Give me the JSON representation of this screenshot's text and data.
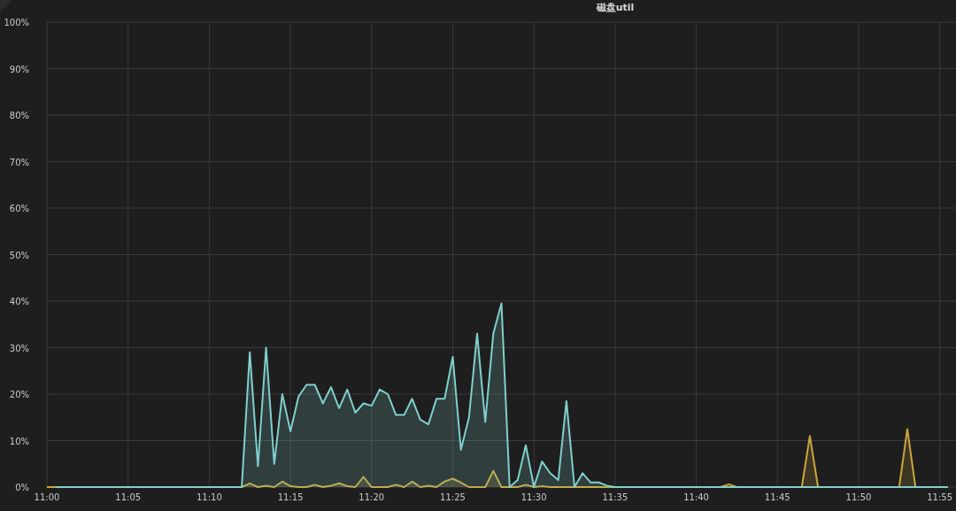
{
  "panel": {
    "title": "磁盘util",
    "chart_data": {
      "type": "area",
      "grid": true,
      "categories": [
        "11:00",
        null,
        null,
        null,
        null,
        null,
        null,
        null,
        null,
        null,
        "11:05",
        null,
        null,
        null,
        null,
        null,
        null,
        null,
        null,
        null,
        "11:10",
        null,
        null,
        null,
        null,
        null,
        null,
        null,
        null,
        null,
        "11:15",
        null,
        null,
        null,
        null,
        null,
        null,
        null,
        null,
        null,
        "11:20",
        null,
        null,
        null,
        null,
        null,
        null,
        null,
        null,
        null,
        "11:25",
        null,
        null,
        null,
        null,
        null,
        null,
        null,
        null,
        null,
        "11:30",
        null,
        null,
        null,
        null,
        null,
        null,
        null,
        null,
        null,
        "11:35",
        null,
        null,
        null,
        null,
        null,
        null,
        null,
        null,
        null,
        "11:40",
        null,
        null,
        null,
        null,
        null,
        null,
        null,
        null,
        null,
        "11:45",
        null,
        null,
        null,
        null,
        null,
        null,
        null,
        null,
        null,
        "11:50",
        null,
        null,
        null,
        null,
        null,
        null,
        null,
        null,
        null,
        "11:55",
        null
      ],
      "series": [
        {
          "color": "#7fd0cc",
          "values": [
            null,
            0,
            0,
            0,
            0,
            0,
            0,
            0,
            0,
            0,
            0,
            0,
            0,
            0,
            0,
            0,
            0,
            0,
            0,
            0,
            0,
            0,
            0,
            0,
            0,
            29,
            4.5,
            30,
            5,
            20,
            12,
            19.5,
            22,
            22,
            18,
            21.5,
            17,
            21,
            16,
            18,
            17.5,
            21,
            20,
            15.5,
            15.5,
            19,
            14.5,
            13.5,
            19,
            19,
            28,
            8,
            15,
            33,
            14,
            33,
            39.5,
            0,
            1.5,
            9,
            0,
            5.5,
            3,
            1.5,
            18.5,
            0,
            3,
            1,
            1,
            0.3,
            0,
            0,
            0,
            0,
            0,
            0,
            0,
            0,
            0,
            0,
            0,
            0,
            0,
            0,
            0,
            0,
            0,
            0,
            0,
            0,
            0,
            0,
            0,
            0,
            0,
            0,
            0,
            0,
            0,
            0,
            0,
            0,
            0,
            0,
            0,
            0,
            0,
            0,
            0,
            0,
            0,
            0
          ]
        },
        {
          "color": "#c9a63c",
          "values": [
            0,
            0,
            0,
            0,
            0,
            0,
            0,
            0,
            0,
            0,
            0,
            0,
            0,
            0,
            0,
            0,
            0,
            0,
            0,
            0,
            0,
            0,
            0,
            0,
            0,
            0.8,
            0,
            0.3,
            0,
            1.2,
            0.2,
            0,
            0,
            0.5,
            0,
            0.3,
            0.8,
            0.2,
            0,
            2.2,
            0,
            0,
            0,
            0.5,
            0,
            1.2,
            0,
            0.3,
            0,
            1.2,
            1.8,
            1,
            0,
            0,
            0,
            3.5,
            0,
            0,
            0,
            0.5,
            0,
            0.2,
            0,
            0,
            0,
            0,
            0,
            0,
            0,
            0,
            0,
            0,
            0,
            0,
            0,
            0,
            0,
            0,
            0,
            0,
            0,
            0,
            0,
            0,
            0.6,
            0,
            0,
            0,
            0,
            0,
            0,
            0,
            0,
            0,
            11,
            0,
            0,
            0,
            0,
            0,
            0,
            0,
            0,
            0,
            0,
            0,
            12.5,
            0,
            0,
            0,
            0,
            0
          ]
        }
      ],
      "ylim": [
        0,
        100
      ],
      "yticks": [
        {
          "value": 0,
          "label": "0%"
        },
        {
          "value": 10,
          "label": "10%"
        },
        {
          "value": 20,
          "label": "20%"
        },
        {
          "value": 30,
          "label": "30%"
        },
        {
          "value": 40,
          "label": "40%"
        },
        {
          "value": 50,
          "label": "50%"
        },
        {
          "value": 60,
          "label": "60%"
        },
        {
          "value": 70,
          "label": "70%"
        },
        {
          "value": 80,
          "label": "80%"
        },
        {
          "value": 90,
          "label": "90%"
        },
        {
          "value": 100,
          "label": "100%"
        }
      ]
    }
  }
}
